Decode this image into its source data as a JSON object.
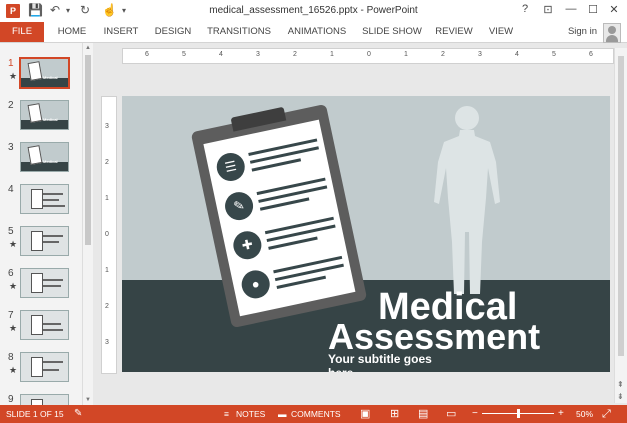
{
  "window": {
    "title": "medical_assessment_16526.pptx - PowerPoint",
    "app_icon": "P",
    "quick_access": [
      "save-icon",
      "undo-icon",
      "redo-icon",
      "touch-mode-icon",
      "customize-icon"
    ],
    "controls": {
      "help": "?",
      "ribbon_display": "⊡",
      "minimize": "—",
      "maximize": "☐",
      "close": "✕"
    }
  },
  "ribbon": {
    "tabs": [
      "FILE",
      "HOME",
      "INSERT",
      "DESIGN",
      "TRANSITIONS",
      "ANIMATIONS",
      "SLIDE SHOW",
      "REVIEW",
      "VIEW"
    ],
    "active_tab": "FILE",
    "sign_in": "Sign in"
  },
  "thumbnails": [
    {
      "num": "1",
      "starred": true,
      "active": true,
      "style": "title"
    },
    {
      "num": "2",
      "starred": false,
      "active": false,
      "style": "title"
    },
    {
      "num": "3",
      "starred": false,
      "active": false,
      "style": "title"
    },
    {
      "num": "4",
      "starred": false,
      "active": false,
      "style": "list"
    },
    {
      "num": "5",
      "starred": true,
      "active": false,
      "style": "list"
    },
    {
      "num": "6",
      "starred": true,
      "active": false,
      "style": "list"
    },
    {
      "num": "7",
      "starred": true,
      "active": false,
      "style": "list"
    },
    {
      "num": "8",
      "starred": true,
      "active": false,
      "style": "list"
    },
    {
      "num": "9",
      "starred": false,
      "active": false,
      "style": "list"
    }
  ],
  "rulers": {
    "horizontal": [
      "6",
      "5",
      "4",
      "3",
      "2",
      "1",
      "0",
      "1",
      "2",
      "3",
      "4",
      "5",
      "6"
    ],
    "vertical": [
      "3",
      "2",
      "1",
      "0",
      "1",
      "2",
      "3"
    ]
  },
  "slide": {
    "title_line1": "Medical",
    "title_line2": "Assessment",
    "subtitle": "Your subtitle goes here",
    "colors": {
      "background": "#c1cbcd",
      "band": "#364446",
      "clipboard": "#5d5d5d",
      "silhouette": "#dde4e5"
    },
    "clipboard_icons": [
      "clipboard-list-icon",
      "syringe-icon",
      "bandage-icon",
      "pills-icon"
    ]
  },
  "status": {
    "slide_info": "SLIDE 1 OF 15",
    "notes": "NOTES",
    "comments": "COMMENTS",
    "zoom": "50%",
    "accent": "#d24726"
  }
}
